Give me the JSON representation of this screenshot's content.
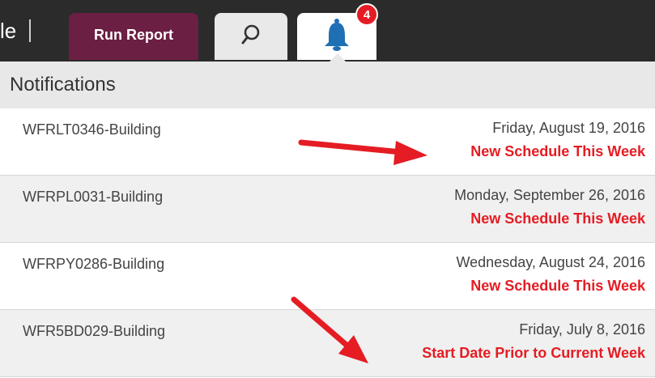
{
  "header": {
    "brand_fragment": "le",
    "run_report_label": "Run Report",
    "search_icon": "search-icon",
    "bell_icon": "bell-icon",
    "badge_count": "4",
    "accent": "#6b1f42",
    "badge_color": "#e51c23"
  },
  "notifications": {
    "title": "Notifications",
    "status_color": "#e51c23",
    "items": [
      {
        "name": "WFRLT0346-Building",
        "date": "Friday, August 19, 2016",
        "status": "New Schedule This Week"
      },
      {
        "name": "WFRPL0031-Building",
        "date": "Monday, September 26, 2016",
        "status": "New Schedule This Week"
      },
      {
        "name": "WFRPY0286-Building",
        "date": "Wednesday, August 24, 2016",
        "status": "New Schedule This Week"
      },
      {
        "name": "WFR5BD029-Building",
        "date": "Friday, July 8, 2016",
        "status": "Start Date Prior to Current Week"
      }
    ]
  }
}
